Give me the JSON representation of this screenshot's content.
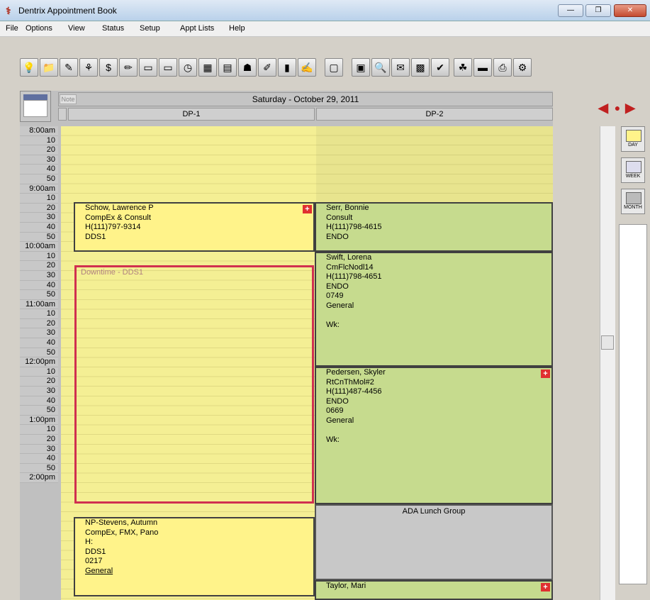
{
  "window": {
    "title": "Dentrix Appointment Book"
  },
  "menu": [
    "File",
    "Options",
    "View",
    "Status",
    "Setup",
    "Appt Lists",
    "Help"
  ],
  "schedule": {
    "date": "Saturday - October 29, 2011",
    "note_label": "Note",
    "columns": [
      "DP-1",
      "DP-2"
    ],
    "times": [
      "8:00am",
      "10",
      "20",
      "30",
      "40",
      "50",
      "9:00am",
      "10",
      "20",
      "30",
      "40",
      "50",
      "10:00am",
      "10",
      "20",
      "30",
      "40",
      "50",
      "11:00am",
      "10",
      "20",
      "30",
      "40",
      "50",
      "12:00pm",
      "10",
      "20",
      "30",
      "40",
      "50",
      "1:00pm",
      "10",
      "20",
      "30",
      "40",
      "50",
      "2:00pm"
    ]
  },
  "appointments": {
    "schow": [
      "Schow, Lawrence P",
      "CompEx & Consult",
      "H(111)797-9314",
      "DDS1"
    ],
    "serr": [
      "Serr, Bonnie",
      "Consult",
      "H(111)798-4615",
      "ENDO"
    ],
    "swift": [
      "Swift, Lorena",
      "CmFlcNodl14",
      "H(111)798-4651",
      "ENDO",
      "0749",
      "General",
      "",
      "Wk:"
    ],
    "pedersen": [
      "Pedersen, Skyler",
      "RtCnThMol#2",
      "H(111)487-4456",
      "ENDO",
      "0669",
      "General",
      "",
      "Wk:"
    ],
    "stevens": [
      "NP-Stevens, Autumn",
      "CompEx, FMX, Pano",
      "H:",
      "DDS1",
      "0217",
      "General"
    ],
    "taylor": [
      "Taylor, Mari"
    ]
  },
  "blocks": {
    "lunch": "ADA Lunch Group",
    "downtime": "Downtime - DDS1"
  },
  "side": {
    "day": "DAY",
    "week": "WEEK",
    "month": "MONTH"
  }
}
